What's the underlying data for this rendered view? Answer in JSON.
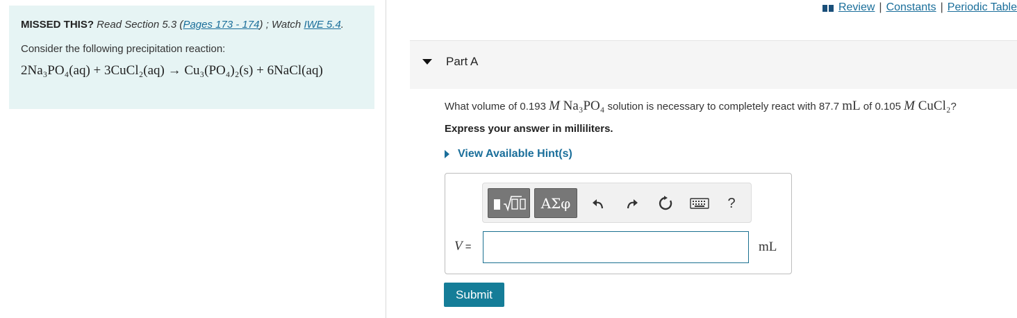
{
  "left": {
    "missed_label": "MISSED THIS?",
    "read_text": " Read Section 5.3 (",
    "pages_link": "Pages 173 - 174",
    "after_pages": ") ; Watch ",
    "iwe_link": "IWE 5.4",
    "end_text": ".",
    "consider": "Consider the following precipitation reaction:",
    "reaction": "2Na₃PO₄(aq) + 3CuCl₂(aq) → Cu₃(PO₄)₂(s) + 6NaCl(aq)"
  },
  "top_links": {
    "review": "Review",
    "constants": "Constants",
    "periodic_table": "Periodic Table",
    "separator": "|"
  },
  "part": {
    "title": "Part A"
  },
  "question": {
    "q1": "What volume of 0.193 ",
    "m1": "M",
    "f1": " Na₃PO₄",
    "q2": " solution is necessary to completely react with 87.7 ",
    "ml": "mL",
    "q3": " of 0.105 ",
    "m2": "M",
    "f2": " CuCl₂",
    "q4": "?"
  },
  "express": "Express your answer in milliliters.",
  "hint": "View Available Hint(s)",
  "toolbar": {
    "symbols_label": "ΑΣφ",
    "help_label": "?"
  },
  "answer": {
    "var": "V",
    "equals": " =",
    "value": "",
    "unit": "mL"
  },
  "submit_label": "Submit",
  "colors": {
    "link": "#1a6e9a",
    "submit_bg": "#157d98",
    "left_bg": "#e6f4f4"
  }
}
